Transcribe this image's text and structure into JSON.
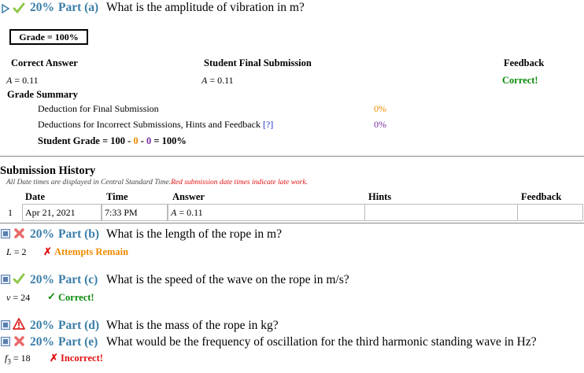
{
  "part_a": {
    "percent": "20%",
    "label": "Part (a)",
    "question": "What is the amplitude of vibration in m?",
    "grade_box": "Grade = 100%",
    "headers": {
      "correct": "Correct Answer",
      "student": "Student Final Submission",
      "feedback": "Feedback"
    },
    "correct_answer_var": "A",
    "correct_answer_value": " = 0.11",
    "student_answer_var": "A",
    "student_answer_value": " = 0.11",
    "feedback": "Correct!",
    "grade_summary_title": "Grade Summary",
    "deduction_final_label": "Deduction for Final Submission",
    "deduction_final_value": "0%",
    "deduction_incorrect_label": "Deductions for Incorrect Submissions, Hints and Feedback ",
    "deduction_incorrect_link": "[?]",
    "deduction_incorrect_value": "0%",
    "student_grade_prefix": "Student Grade = 100 - ",
    "student_grade_d1": "0",
    "student_grade_mid": " - ",
    "student_grade_d2": "0",
    "student_grade_suffix": " = 100%"
  },
  "history": {
    "title": "Submission History",
    "note": "All Date times are displayed in Central Standard Time.",
    "note_red": "Red submission date times indicate late work.",
    "headers": {
      "date": "Date",
      "time": "Time",
      "answer": "Answer",
      "hints": "Hints",
      "feedback": "Feedback"
    },
    "rows": [
      {
        "num": "1",
        "date": "Apr 21, 2021",
        "time": "7:33 PM",
        "answer_var": "A",
        "answer_value": " = 0.11"
      }
    ]
  },
  "part_b": {
    "percent": "20%",
    "label": "Part (b)",
    "question": "What is the length of the rope in m?",
    "answer_var": "L",
    "answer_value": " = 2",
    "status": "Attempts Remain"
  },
  "part_c": {
    "percent": "20%",
    "label": "Part (c)",
    "question": "What is the speed of the wave on the rope in m/s?",
    "answer_var": "v",
    "answer_value": " = 24",
    "status": "Correct!"
  },
  "part_d": {
    "percent": "20%",
    "label": "Part (d)",
    "question": "What is the mass of the rope in kg?"
  },
  "part_e": {
    "percent": "20%",
    "label": "Part (e)",
    "question": "What would be the frequency of oscillation for the third harmonic standing wave in Hz?",
    "answer_var": "f",
    "answer_sub": "3",
    "answer_value": " = 18",
    "status": "Incorrect!"
  },
  "colors": {
    "part_label": "#3a7da8",
    "correct": "#0a8a0a",
    "incorrect": "#e01010",
    "warning": "#f08a00",
    "deduction": "#7b2fa0"
  }
}
